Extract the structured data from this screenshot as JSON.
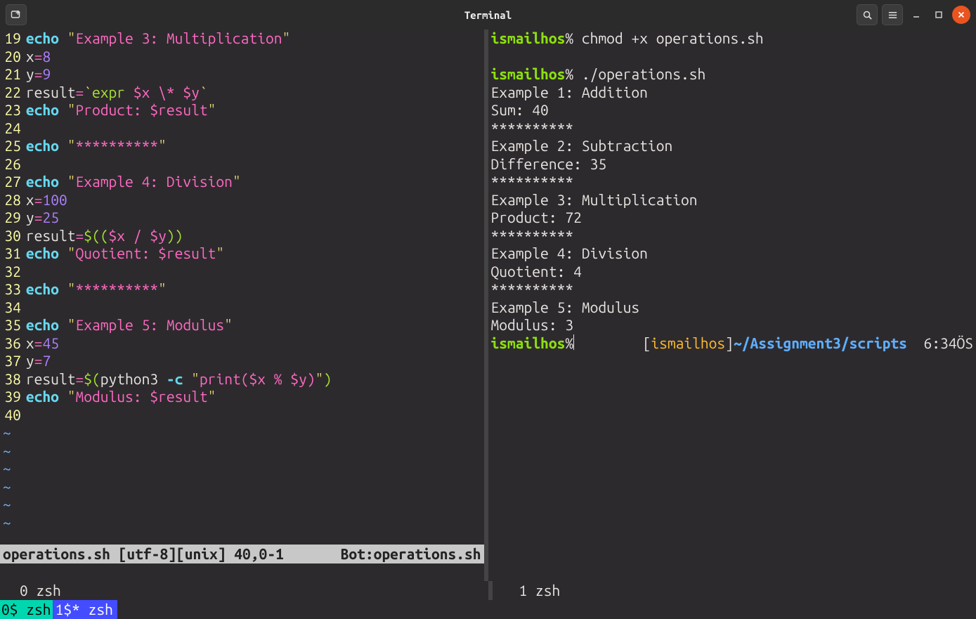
{
  "titlebar": {
    "title": "Terminal"
  },
  "editor": {
    "status_left": "operations.sh [utf-8][unix]   40,0-1",
    "status_right": "Bot:operations.sh",
    "lines": [
      {
        "n": 19,
        "seg": [
          [
            "kw",
            "echo"
          ],
          [
            "punc",
            " "
          ],
          [
            "dq",
            "\""
          ],
          [
            "strM",
            "Example 3: Multiplication"
          ],
          [
            "dq",
            "\""
          ]
        ]
      },
      {
        "n": 20,
        "seg": [
          [
            "var",
            "x"
          ],
          [
            "op",
            "="
          ],
          [
            "num",
            "8"
          ]
        ]
      },
      {
        "n": 21,
        "seg": [
          [
            "var",
            "y"
          ],
          [
            "op",
            "="
          ],
          [
            "num",
            "9"
          ]
        ]
      },
      {
        "n": 22,
        "seg": [
          [
            "var",
            "result"
          ],
          [
            "op",
            "="
          ],
          [
            "str",
            "`"
          ],
          [
            "fn",
            "expr"
          ],
          [
            "str",
            " "
          ],
          [
            "varM",
            "$x"
          ],
          [
            "str",
            " "
          ],
          [
            "op",
            "\\*"
          ],
          [
            "str",
            " "
          ],
          [
            "varM",
            "$y"
          ],
          [
            "str",
            "`"
          ]
        ]
      },
      {
        "n": 23,
        "seg": [
          [
            "kw",
            "echo"
          ],
          [
            "punc",
            " "
          ],
          [
            "dq",
            "\""
          ],
          [
            "strM",
            "Product: "
          ],
          [
            "varM",
            "$result"
          ],
          [
            "dq",
            "\""
          ]
        ]
      },
      {
        "n": 24,
        "seg": []
      },
      {
        "n": 25,
        "seg": [
          [
            "kw",
            "echo"
          ],
          [
            "punc",
            " "
          ],
          [
            "dq",
            "\""
          ],
          [
            "strM",
            "**********"
          ],
          [
            "dq",
            "\""
          ]
        ]
      },
      {
        "n": 26,
        "seg": []
      },
      {
        "n": 27,
        "seg": [
          [
            "kw",
            "echo"
          ],
          [
            "punc",
            " "
          ],
          [
            "dq",
            "\""
          ],
          [
            "strM",
            "Example 4: Division"
          ],
          [
            "dq",
            "\""
          ]
        ]
      },
      {
        "n": 28,
        "seg": [
          [
            "var",
            "x"
          ],
          [
            "op",
            "="
          ],
          [
            "num",
            "100"
          ]
        ]
      },
      {
        "n": 29,
        "seg": [
          [
            "var",
            "y"
          ],
          [
            "op",
            "="
          ],
          [
            "num",
            "25"
          ]
        ]
      },
      {
        "n": 30,
        "seg": [
          [
            "var",
            "result"
          ],
          [
            "op",
            "="
          ],
          [
            "fn",
            "$(("
          ],
          [
            "varM",
            "$x"
          ],
          [
            "punc",
            " "
          ],
          [
            "op",
            "/"
          ],
          [
            "punc",
            " "
          ],
          [
            "varM",
            "$y"
          ],
          [
            "fn",
            "))"
          ]
        ]
      },
      {
        "n": 31,
        "seg": [
          [
            "kw",
            "echo"
          ],
          [
            "punc",
            " "
          ],
          [
            "dq",
            "\""
          ],
          [
            "strM",
            "Quotient: "
          ],
          [
            "varM",
            "$result"
          ],
          [
            "dq",
            "\""
          ]
        ]
      },
      {
        "n": 32,
        "seg": []
      },
      {
        "n": 33,
        "seg": [
          [
            "kw",
            "echo"
          ],
          [
            "punc",
            " "
          ],
          [
            "dq",
            "\""
          ],
          [
            "strM",
            "**********"
          ],
          [
            "dq",
            "\""
          ]
        ]
      },
      {
        "n": 34,
        "seg": []
      },
      {
        "n": 35,
        "seg": [
          [
            "kw",
            "echo"
          ],
          [
            "punc",
            " "
          ],
          [
            "dq",
            "\""
          ],
          [
            "strM",
            "Example 5: Modulus"
          ],
          [
            "dq",
            "\""
          ]
        ]
      },
      {
        "n": 36,
        "seg": [
          [
            "var",
            "x"
          ],
          [
            "op",
            "="
          ],
          [
            "num",
            "45"
          ]
        ]
      },
      {
        "n": 37,
        "seg": [
          [
            "var",
            "y"
          ],
          [
            "op",
            "="
          ],
          [
            "num",
            "7"
          ]
        ]
      },
      {
        "n": 38,
        "seg": [
          [
            "var",
            "result"
          ],
          [
            "op",
            "="
          ],
          [
            "fn",
            "$("
          ],
          [
            "var",
            "python3 "
          ],
          [
            "kw",
            "-c"
          ],
          [
            "punc",
            " "
          ],
          [
            "dq",
            "\""
          ],
          [
            "strM",
            "print("
          ],
          [
            "varM",
            "$x"
          ],
          [
            "strM",
            " % "
          ],
          [
            "varM",
            "$y"
          ],
          [
            "strM",
            ")"
          ],
          [
            "dq",
            "\""
          ],
          [
            "fn",
            ")"
          ]
        ]
      },
      {
        "n": 39,
        "seg": [
          [
            "kw",
            "echo"
          ],
          [
            "punc",
            " "
          ],
          [
            "dq",
            "\""
          ],
          [
            "strM",
            "Modulus: "
          ],
          [
            "varM",
            "$result"
          ],
          [
            "dq",
            "\""
          ]
        ]
      },
      {
        "n": 40,
        "seg": []
      }
    ],
    "eof_lines": 6
  },
  "shell": {
    "host": "ismailhos",
    "prompt_sep": "%",
    "entries": [
      {
        "cmd": "chmod +x operations.sh",
        "out": []
      },
      {
        "cmd": "./operations.sh",
        "out": [
          "Example 1: Addition",
          "Sum: 40",
          "**********",
          "Example 2: Subtraction",
          "Difference: 35",
          "**********",
          "Example 3: Multiplication",
          "Product: 72",
          "**********",
          "Example 4: Division",
          "Quotient: 4",
          "**********",
          "Example 5: Modulus",
          "Modulus: 3"
        ]
      }
    ],
    "rprompt": {
      "user": "ismailhos",
      "path": "~/Assignment3/scripts",
      "time": "6:34ÖS"
    }
  },
  "tmux": {
    "pane_left": "0 zsh",
    "pane_right": "1 zsh",
    "bar_seg1": "0$ zsh ",
    "bar_seg2": "1$* zsh"
  }
}
